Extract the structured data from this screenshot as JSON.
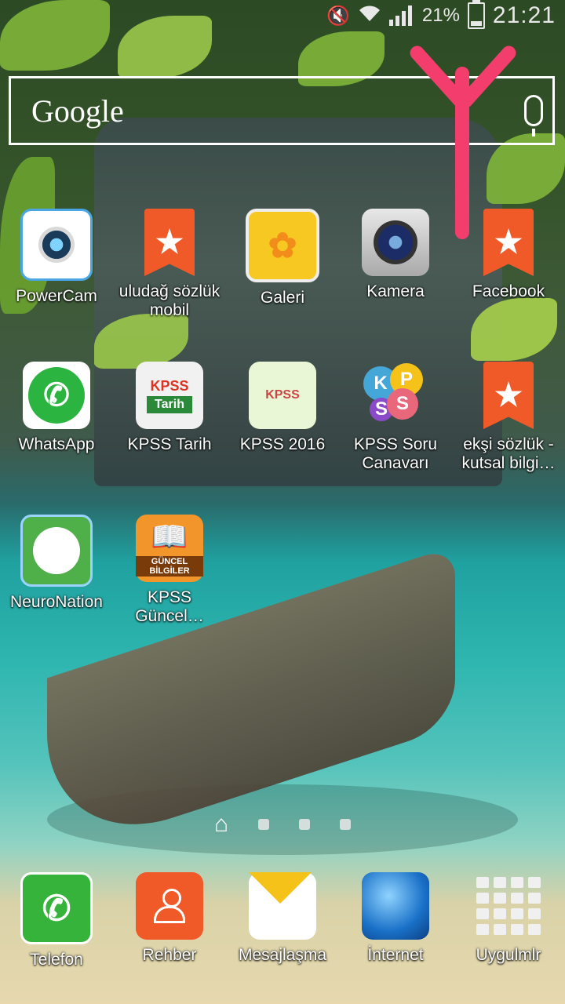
{
  "status_bar": {
    "battery_text": "21%",
    "battery_level": 0.21,
    "time": "21:21",
    "icons": [
      "mute-icon",
      "wifi-icon",
      "signal-icon",
      "battery-icon"
    ]
  },
  "search": {
    "brand": "Google",
    "icon": "mic-icon"
  },
  "apps": [
    {
      "label": "PowerCam",
      "icon": "camera-app-icon"
    },
    {
      "label": "uludağ sözlük mobil",
      "icon": "bookmark-star-icon"
    },
    {
      "label": "Galeri",
      "icon": "gallery-icon"
    },
    {
      "label": "Kamera",
      "icon": "camera-icon"
    },
    {
      "label": "Facebook",
      "icon": "bookmark-star-icon"
    },
    {
      "label": "WhatsApp",
      "icon": "whatsapp-icon"
    },
    {
      "label": "KPSS Tarih",
      "icon": "kpss-tarih-icon",
      "icon_text": "KPSS",
      "icon_sub": "Tarih"
    },
    {
      "label": "KPSS 2016",
      "icon": "kpss-2016-icon",
      "icon_text": "KPSS"
    },
    {
      "label": "KPSS Soru Canavarı",
      "icon": "kpss-soru-canavari-icon",
      "icon_letters": [
        "K",
        "P",
        "S",
        "S"
      ]
    },
    {
      "label": "ekşi sözlük - kutsal bilgi…",
      "icon": "bookmark-star-icon"
    },
    {
      "label": "NeuroNation",
      "icon": "neuronation-icon"
    },
    {
      "label": "KPSS Güncel…",
      "icon": "kpss-guncel-icon",
      "icon_text": "GÜNCEL BİLGİLER"
    }
  ],
  "pager": {
    "pages": 3,
    "current": "home"
  },
  "dock": [
    {
      "label": "Telefon",
      "icon": "phone-icon"
    },
    {
      "label": "Rehber",
      "icon": "contacts-icon"
    },
    {
      "label": "Mesajlaşma",
      "icon": "messaging-icon"
    },
    {
      "label": "İnternet",
      "icon": "globe-icon"
    },
    {
      "label": "Uygulmlr",
      "icon": "apps-grid-icon"
    }
  ],
  "colors": {
    "arrow": "#f23d6d",
    "bookmark": "#f05a28",
    "whatsapp": "#2bb540"
  }
}
